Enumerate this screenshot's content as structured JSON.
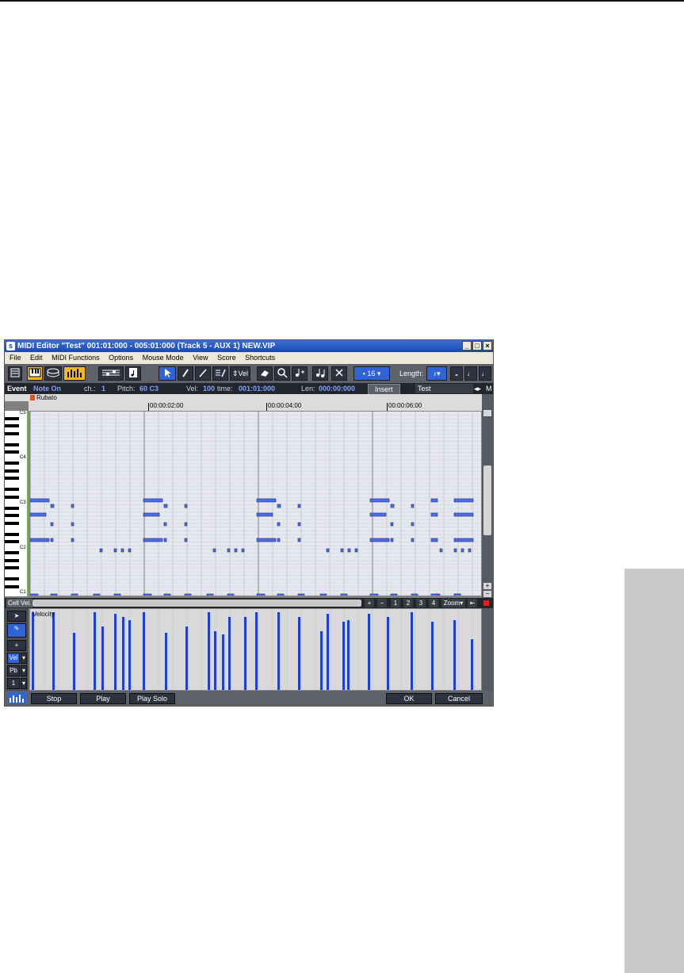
{
  "window": {
    "title": "MIDI Editor \"Test\" 001:01:000 - 005:01:000 (Track 5 - AUX 1) NEW.VIP",
    "app_icon": "s",
    "minimize": "_",
    "maximize": "□",
    "close": "×"
  },
  "menu": [
    "File",
    "Edit",
    "MIDI Functions",
    "Options",
    "Mouse Mode",
    "View",
    "Score",
    "Shortcuts"
  ],
  "toolbar": {
    "vel_label": "Vel",
    "quantize_value": "16",
    "length_label": "Length:"
  },
  "event_bar": {
    "event_label": "Event",
    "event_type": "Note On",
    "channel_label": "ch.:",
    "channel_value": "1",
    "pitch_label": "Pitch:",
    "pitch_value": "60 C3",
    "vel_label": "Vel:",
    "vel_value": "100",
    "time_label": "time:",
    "time_value": "001:01:000",
    "len_label": "Len:",
    "len_value": "000:00:000",
    "insert_label": "Insert",
    "name_field": "Test",
    "m_label": "M"
  },
  "marker": "Rubato",
  "ruler": [
    "00:00:02:00",
    "00:00:04:00",
    "00:00:06:00"
  ],
  "keyboard_labels": [
    "C5",
    "C4",
    "C3",
    "C2",
    "C1"
  ],
  "zoom": {
    "plus": "+",
    "minus": "−",
    "levels": [
      "1",
      "2",
      "3",
      "4"
    ],
    "label": "Zoom",
    "end": "⇤"
  },
  "lower": {
    "title": "Velocity",
    "cell_label": "Cell",
    "vel_tab": "Vel.",
    "vel_select": "Vel",
    "pb_select": "Pb",
    "channel_select": "1"
  },
  "buttons": {
    "stop": "Stop",
    "play": "Play",
    "play_solo": "Play Solo",
    "ok": "OK",
    "cancel": "Cancel"
  },
  "colors": {
    "note_fill": "#4f6ee6",
    "velocity_bar": "#1e3ed8",
    "accent_yellow": "#f2b81e",
    "selection_blue": "#2f63d6",
    "side_tab": "#c9c9c9"
  }
}
